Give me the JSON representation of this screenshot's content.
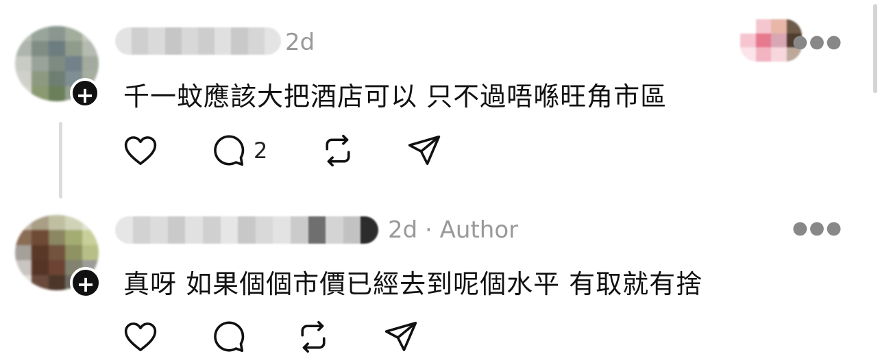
{
  "comments": [
    {
      "meta": "2d",
      "text": "千一蚊應該大把酒店可以 只不過唔喺旺角市區",
      "replies_count": "2",
      "more_icon": "more-horizontal-icon"
    },
    {
      "meta": "2d · Author",
      "text": "真呀 如果個個市價已經去到呢個水平 有取就有捨",
      "more_icon": "more-horizontal-icon"
    }
  ],
  "icons": {
    "like": "heart-icon",
    "reply": "comment-bubble-icon",
    "repost": "repost-icon",
    "share": "send-icon",
    "follow": "plus-icon"
  },
  "colors": {
    "text": "#111111",
    "muted": "#999999",
    "thread_line": "#dcdcdc"
  }
}
